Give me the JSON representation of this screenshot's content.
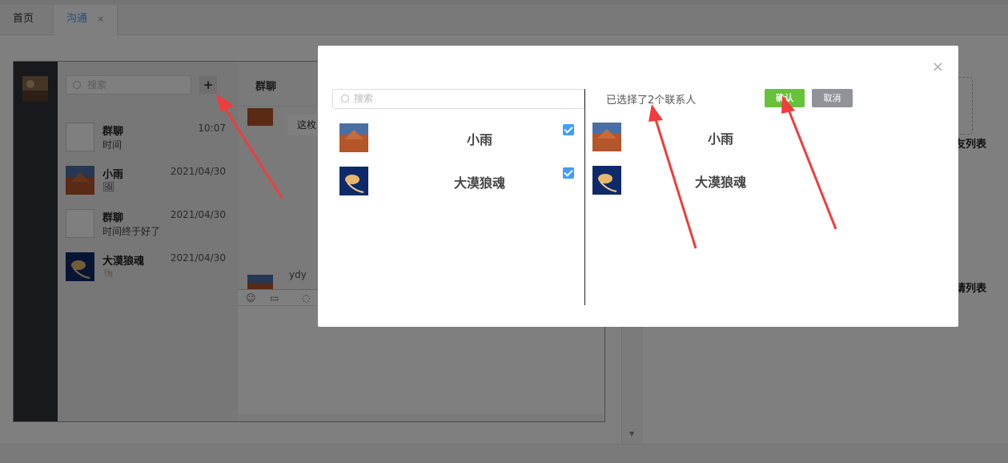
{
  "tabs": [
    {
      "label": "首页",
      "active": false
    },
    {
      "label": "沟通",
      "active": true,
      "close": "×"
    }
  ],
  "sidebar": {
    "search_placeholder": "搜索",
    "add_button": "+",
    "conversations": [
      {
        "name": "群聊",
        "last_message": "时间",
        "time": "10:07",
        "avatar": "broken-image"
      },
      {
        "name": "小雨",
        "last_message": "🖼",
        "time": "2021/04/30",
        "avatar": "desert-photo"
      },
      {
        "name": "群聊",
        "last_message": "时间终于好了",
        "time": "2021/04/30",
        "avatar": "broken-image"
      },
      {
        "name": "大漠狼魂",
        "last_message": "🐚",
        "time": "2021/04/30",
        "avatar": "jellyfish-photo"
      }
    ]
  },
  "chat": {
    "title": "群聊",
    "bubble_text": "这枚",
    "sender": "ydy",
    "toolbar_icons": [
      "emoji-icon",
      "folder-icon",
      "chat-icon"
    ]
  },
  "right_panel": {
    "friend_list_label": "友列表",
    "request_list_label": "申请列表"
  },
  "modal": {
    "close": "×",
    "search_placeholder": "搜索",
    "contacts": [
      {
        "name": "小雨",
        "checked": true,
        "avatar": "desert-photo"
      },
      {
        "name": "大漠狼魂",
        "checked": true,
        "avatar": "jellyfish-photo"
      }
    ],
    "selected_text": "已选择了2个联系人",
    "confirm_label": "确认",
    "cancel_label": "取消",
    "selected": [
      {
        "name": "小雨"
      },
      {
        "name": "大漠狼魂"
      }
    ]
  },
  "colors": {
    "accent_blue": "#409eff",
    "confirm_green": "#67c23a",
    "cancel_gray": "#909399",
    "annotation_red": "#f03c3c"
  }
}
